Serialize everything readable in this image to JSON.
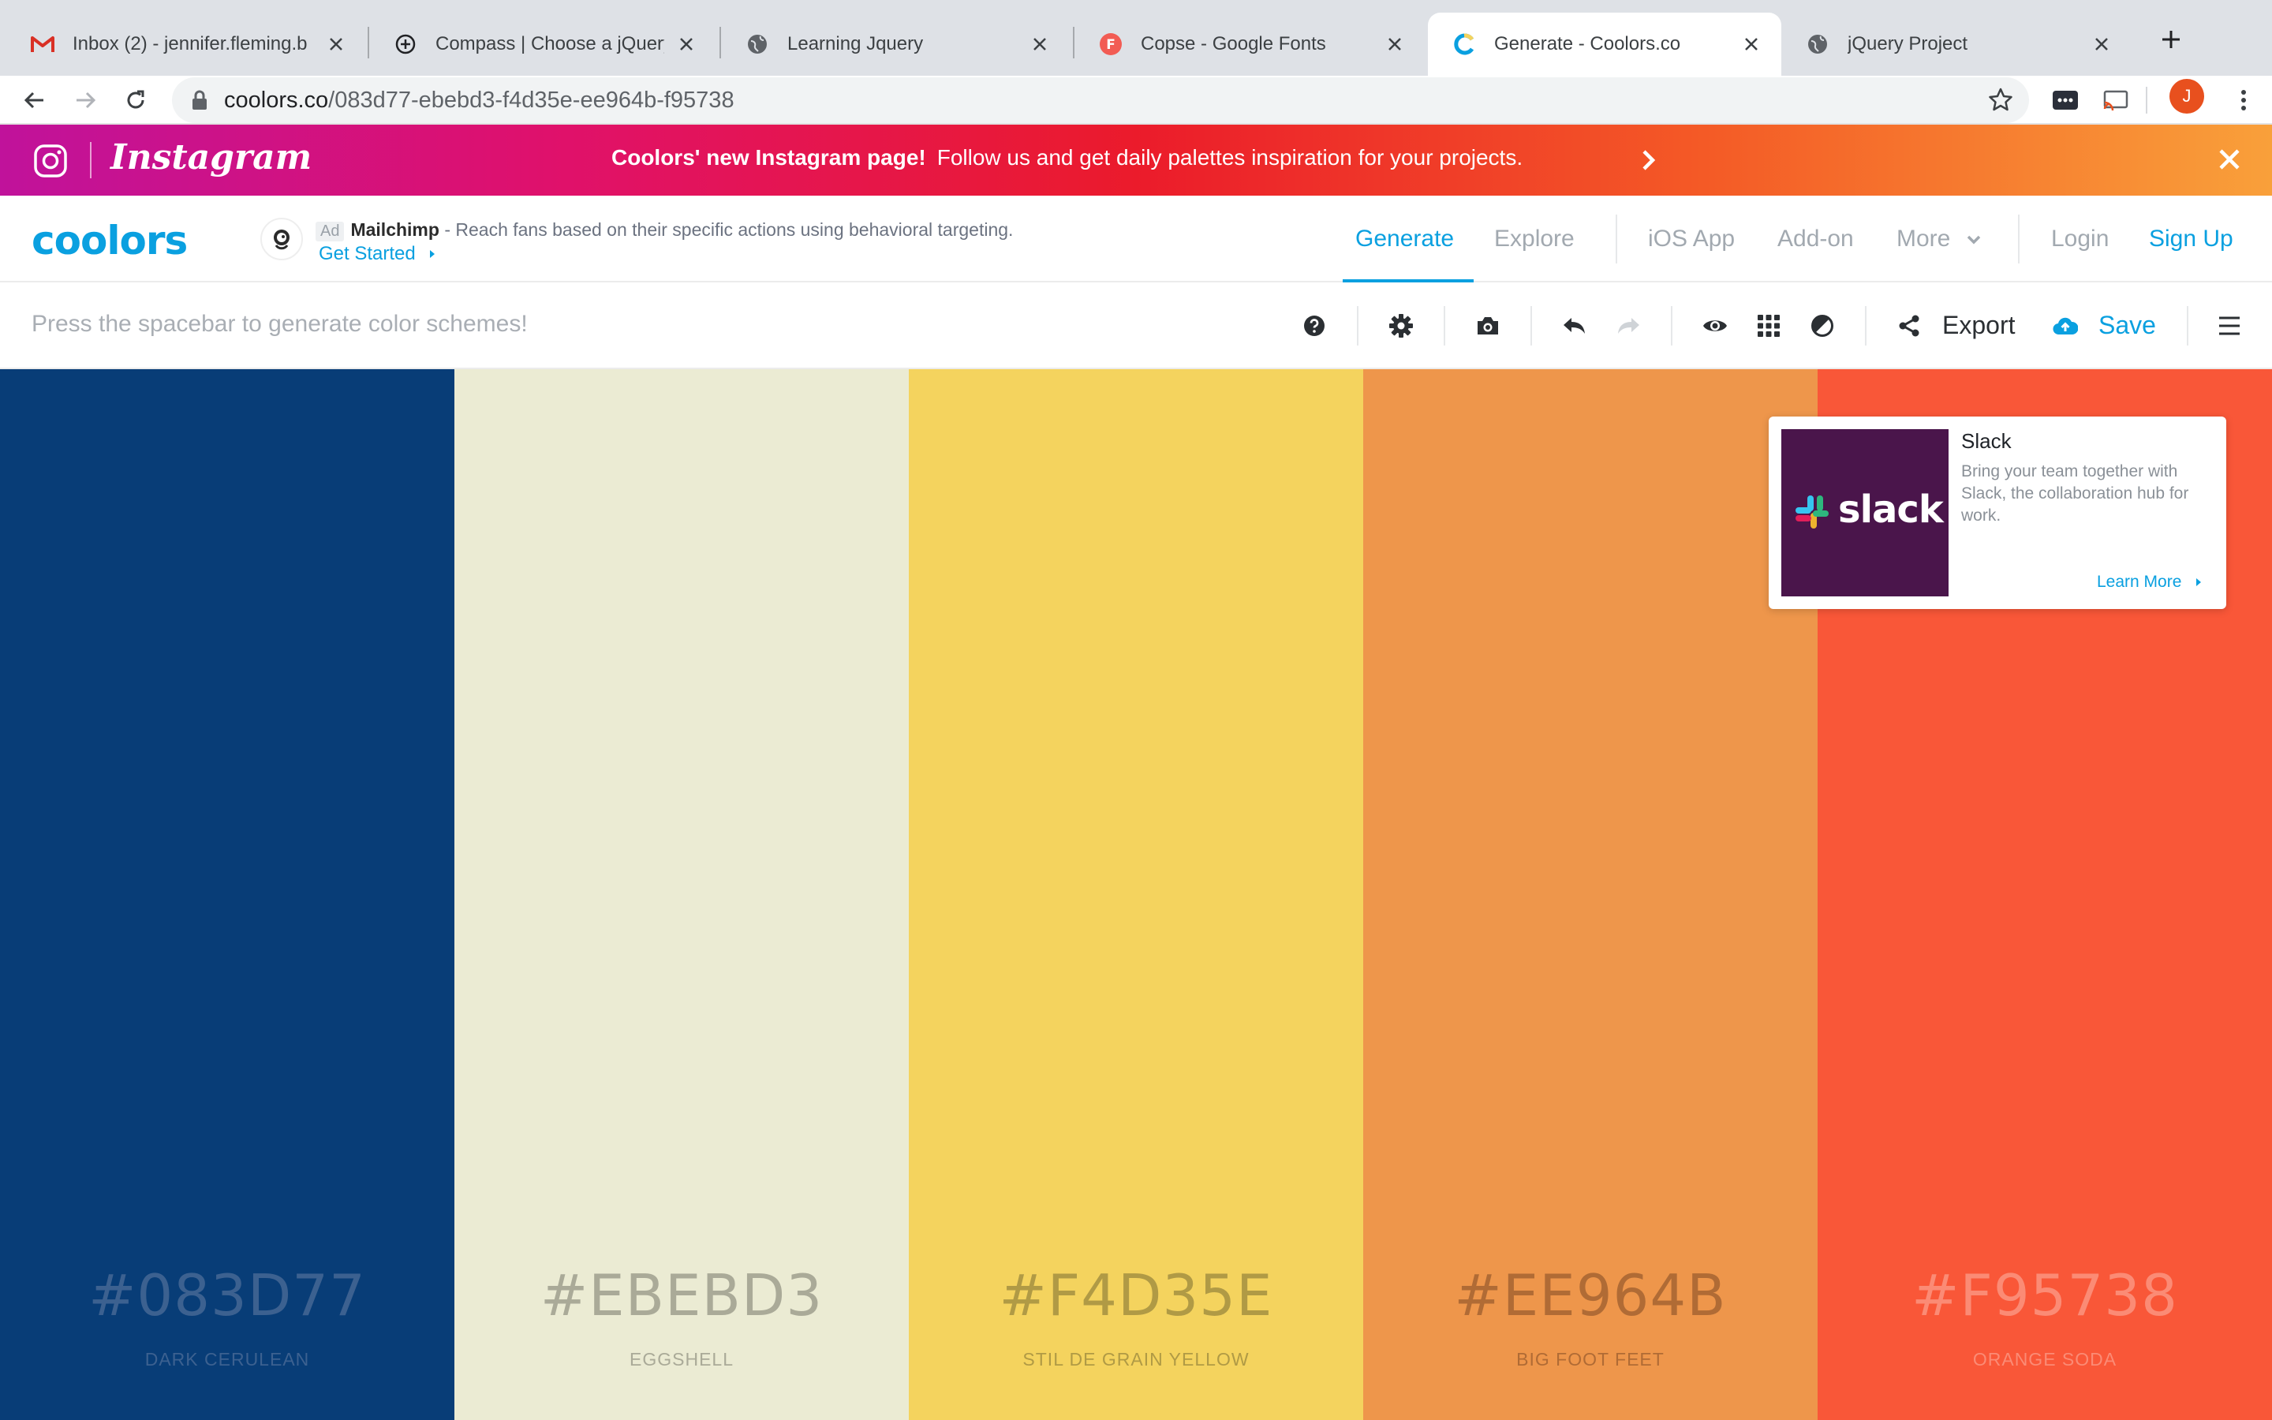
{
  "browser": {
    "tabs": [
      {
        "title": "Inbox (2) - jennifer.fleming.b",
        "favicon": "gmail-icon"
      },
      {
        "title": "Compass | Choose a jQuery",
        "favicon": "compass-icon"
      },
      {
        "title": "Learning Jquery",
        "favicon": "globe-icon"
      },
      {
        "title": "Copse - Google Fonts",
        "favicon": "google-fonts-icon"
      },
      {
        "title": "Generate - Coolors.co",
        "favicon": "coolors-icon",
        "active": true
      },
      {
        "title": "jQuery Project",
        "favicon": "globe-icon"
      }
    ],
    "url_host": "coolors.co",
    "url_path": "/083d77-ebebd3-f4d35e-ee964b-f95738",
    "profile_initial": "J"
  },
  "promo": {
    "brand": "Instagram",
    "headline": "Coolors' new Instagram page!",
    "text": "Follow us and get daily palettes inspiration for your projects."
  },
  "header": {
    "logo": "coolors",
    "ad": {
      "tag": "Ad",
      "sponsor": "Mailchimp",
      "text": " - Reach fans based on their specific actions using behavioral targeting.",
      "cta": "Get Started"
    },
    "nav": {
      "generate": "Generate",
      "explore": "Explore",
      "ios": "iOS App",
      "addon": "Add-on",
      "more": "More",
      "login": "Login",
      "signup": "Sign Up"
    }
  },
  "toolbar": {
    "hint": "Press the spacebar to generate color schemes!",
    "export": "Export",
    "save": "Save"
  },
  "palette": [
    {
      "hex": "#083D77",
      "name": "DARK CERULEAN",
      "color": "#083d77",
      "text_color": "#3c6190"
    },
    {
      "hex": "#EBEBD3",
      "name": "EGGSHELL",
      "color": "#ebebd3",
      "text_color": "#aaaa98"
    },
    {
      "hex": "#F4D35E",
      "name": "STIL DE GRAIN YELLOW",
      "color": "#f4d35e",
      "text_color": "#b09a45"
    },
    {
      "hex": "#EE964B",
      "name": "BIG FOOT FEET",
      "color": "#ee964b",
      "text_color": "#b06b35"
    },
    {
      "hex": "#F95738",
      "name": "ORANGE SODA",
      "color": "#f95738",
      "text_color": "#fb8b75"
    }
  ],
  "slack_ad": {
    "title": "Slack",
    "wordmark": "slack",
    "description": "Bring your team together with Slack, the collaboration hub for work.",
    "cta": "Learn More"
  }
}
